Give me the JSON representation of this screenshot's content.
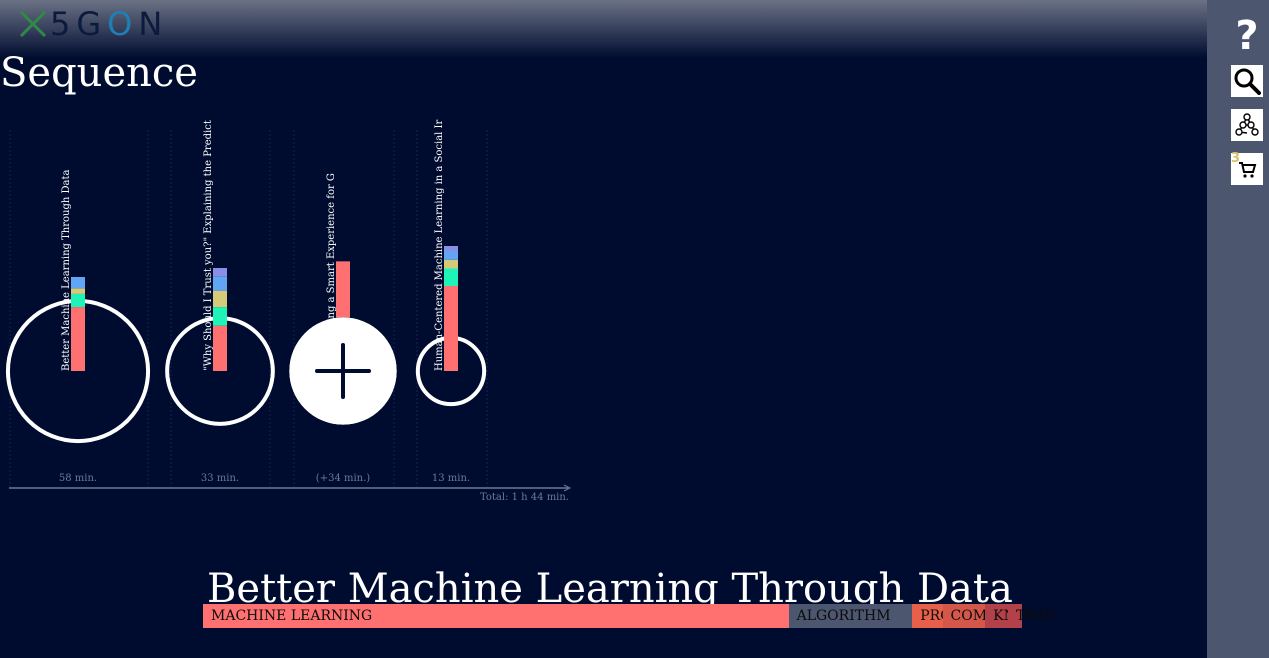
{
  "app": {
    "logo_text": "5G",
    "logo_o": "O",
    "logo_n": "N"
  },
  "page": {
    "title": "Sequence"
  },
  "sidebar": {
    "help_label": "?",
    "cart_count": "3",
    "icons": [
      "search-icon",
      "graph-icon",
      "cart-icon"
    ]
  },
  "sequence": {
    "items": [
      {
        "title": "Better Machine Learning Through Data",
        "duration": "58 min.",
        "minutes": 58,
        "added": true,
        "concepts": [
          0.68,
          0.14,
          0.06,
          0.12
        ],
        "bar_scale": 94
      },
      {
        "title": "\"Why Should I Trust you?\" Explaining the Predict",
        "duration": "33 min.",
        "minutes": 33,
        "added": true,
        "concepts": [
          0.44,
          0.18,
          0.16,
          0.14,
          0.08
        ],
        "bar_scale": 103
      },
      {
        "title": "ess: Building a Smart Experience for G",
        "duration": "(+34 min.)",
        "minutes": 34,
        "added": false,
        "concepts": [
          1.0
        ],
        "bar_scale": 56
      },
      {
        "title": "Human-Centered Machine Learning in a Social Ir",
        "duration": "13 min.",
        "minutes": 13,
        "added": true,
        "concepts": [
          0.68,
          0.14,
          0.07,
          0.07,
          0.04
        ],
        "bar_scale": 125
      }
    ],
    "total": "Total: 1 h 44 min."
  },
  "colors": {
    "background": "#000c2f",
    "concept_ml": "#ff7171",
    "concept_2": "#1ff3b8",
    "concept_3": "#d4ca7a",
    "concept_4": "#61a6f5",
    "concept_5": "#8a8ee6"
  },
  "detail": {
    "title": "Better Machine Learning Through Data",
    "concepts": [
      {
        "label": "MACHINE LEARNING",
        "color": "#ff7171",
        "share": 0.715
      },
      {
        "label": "ALGORITHM",
        "color": "#4c566f",
        "share": 0.151
      },
      {
        "label": "PRO",
        "color": "#e8604a",
        "share": 0.037
      },
      {
        "label": "COM",
        "color": "#d4574a",
        "share": 0.052
      },
      {
        "label": "KNO",
        "color": "#b3414a",
        "share": 0.028
      },
      {
        "label": "TIME",
        "color": "#b3414a",
        "share": 0.017
      }
    ]
  }
}
